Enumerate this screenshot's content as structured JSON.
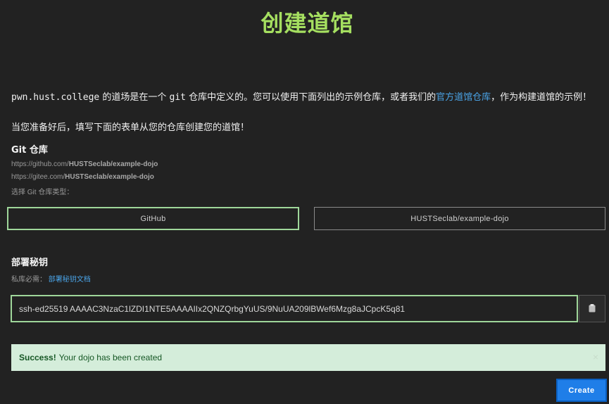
{
  "page": {
    "title": "创建道馆"
  },
  "intro": {
    "domain": "pwn.hust.college",
    "text_a": " 的道场是在一个 ",
    "git": "git",
    "text_b": " 仓库中定义的。您可以使用下面列出的示例仓库，或者我们的",
    "official_link": "官方道馆仓库",
    "text_c": "，作为构建道馆的示例！",
    "ready_text": "当您准备好后，填写下面的表单从您的仓库创建您的道馆！"
  },
  "repo": {
    "label": "Git 仓库",
    "github_prefix": "https://github.com/",
    "github_path": "HUSTSeclab/example-dojo",
    "gitee_prefix": "https://gitee.com/",
    "gitee_path": "HUSTSeclab/example-dojo",
    "type_hint": "选择 Git 仓库类型：",
    "type_value": "GitHub",
    "repo_value": "HUSTSeclab/example-dojo"
  },
  "deploy_key": {
    "label": "部署秘钥",
    "private_required": "私库必需：",
    "doc_link": "部署秘钥文档",
    "value": "ssh-ed25519 AAAAC3NzaC1lZDI1NTE5AAAAIIx2QNZQrbgYuUS/9NuUA209lBWef6Mzg8aJCpcK5q81",
    "copy_icon": "clipboard-icon"
  },
  "alert": {
    "strong": "Success!",
    "message": "Your dojo has been created",
    "close": "×"
  },
  "actions": {
    "create_label": "Create"
  },
  "colors": {
    "title": "#a5df60",
    "link": "#4aa3e6",
    "selected_border": "#9fd79a",
    "success_bg": "#d4edda",
    "success_text": "#155724",
    "primary": "#1f7ee8"
  }
}
